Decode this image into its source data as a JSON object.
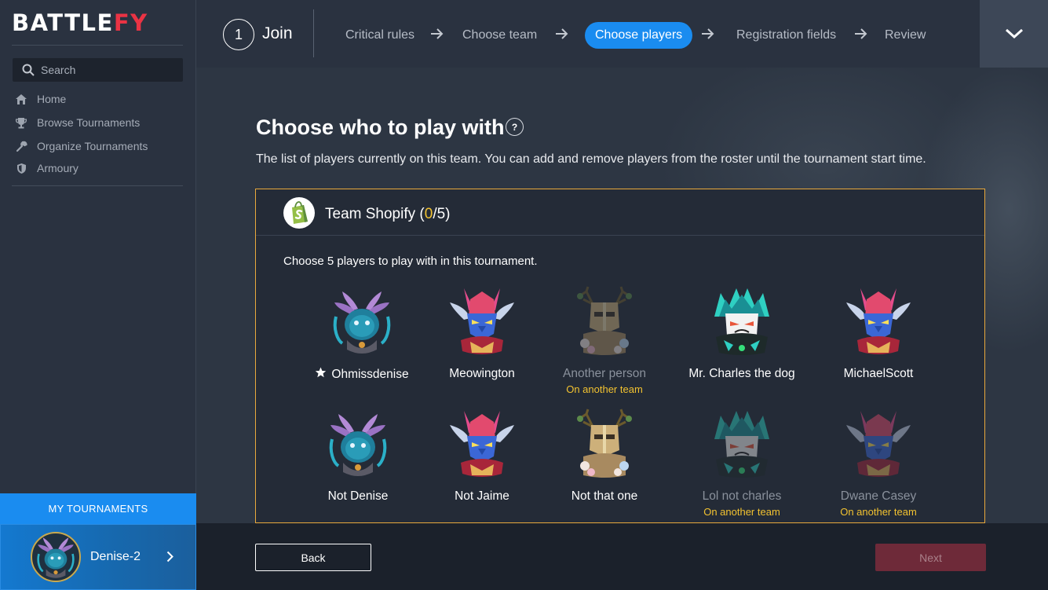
{
  "brand": {
    "part1": "BATTLE",
    "part2": "FY",
    "accent": "#ea3344"
  },
  "sidebar": {
    "search_placeholder": "Search",
    "items": [
      {
        "label": "Home",
        "icon": "home-icon"
      },
      {
        "label": "Browse Tournaments",
        "icon": "trophy-icon"
      },
      {
        "label": "Organize Tournaments",
        "icon": "wrench-icon"
      },
      {
        "label": "Armoury",
        "icon": "shield-icon"
      }
    ],
    "my_tournaments_label": "MY TOURNAMENTS",
    "current_tournament": "Denise-2"
  },
  "wizard": {
    "step_number": "1",
    "step_title": "Join",
    "steps": [
      "Critical rules",
      "Choose team",
      "Choose players",
      "Registration fields",
      "Review"
    ],
    "active_step": "Choose players"
  },
  "main": {
    "heading": "Choose who to play with",
    "help_label": "?",
    "description": "The list of players currently on this team. You can add and remove players from the roster until the tournament start time."
  },
  "team": {
    "name": "Team Shopify",
    "selected": "0",
    "total": "5",
    "instruction": "Choose 5 players to play with in this tournament.",
    "players": [
      {
        "name": "Ohmissdenise",
        "avatar": "moth-avatar",
        "captain": true,
        "available": true,
        "note": ""
      },
      {
        "name": "Meowington",
        "avatar": "horned-knight-avatar",
        "captain": false,
        "available": true,
        "note": ""
      },
      {
        "name": "Another person",
        "avatar": "antler-helm-avatar",
        "captain": false,
        "available": false,
        "note": "On another team"
      },
      {
        "name": "Mr. Charles the dog",
        "avatar": "cyan-flame-avatar",
        "captain": false,
        "available": true,
        "note": ""
      },
      {
        "name": "MichaelScott",
        "avatar": "horned-knight-avatar",
        "captain": false,
        "available": true,
        "note": ""
      },
      {
        "name": "Not Denise",
        "avatar": "moth-avatar",
        "captain": false,
        "available": true,
        "note": ""
      },
      {
        "name": "Not Jaime",
        "avatar": "horned-knight-avatar",
        "captain": false,
        "available": true,
        "note": ""
      },
      {
        "name": "Not that one",
        "avatar": "antler-helm-avatar",
        "captain": false,
        "available": true,
        "note": ""
      },
      {
        "name": "Lol not charles",
        "avatar": "cyan-flame-avatar",
        "captain": false,
        "available": false,
        "note": "On another team"
      },
      {
        "name": "Dwane Casey",
        "avatar": "horned-knight-avatar",
        "captain": false,
        "available": false,
        "note": "On another team"
      }
    ]
  },
  "footer": {
    "back_label": "Back",
    "next_label": "Next"
  },
  "colors": {
    "primary": "#1a8cf0",
    "highlight": "#f2c230",
    "panel_border": "#e9a93c",
    "next_disabled": "#6e2a39"
  }
}
